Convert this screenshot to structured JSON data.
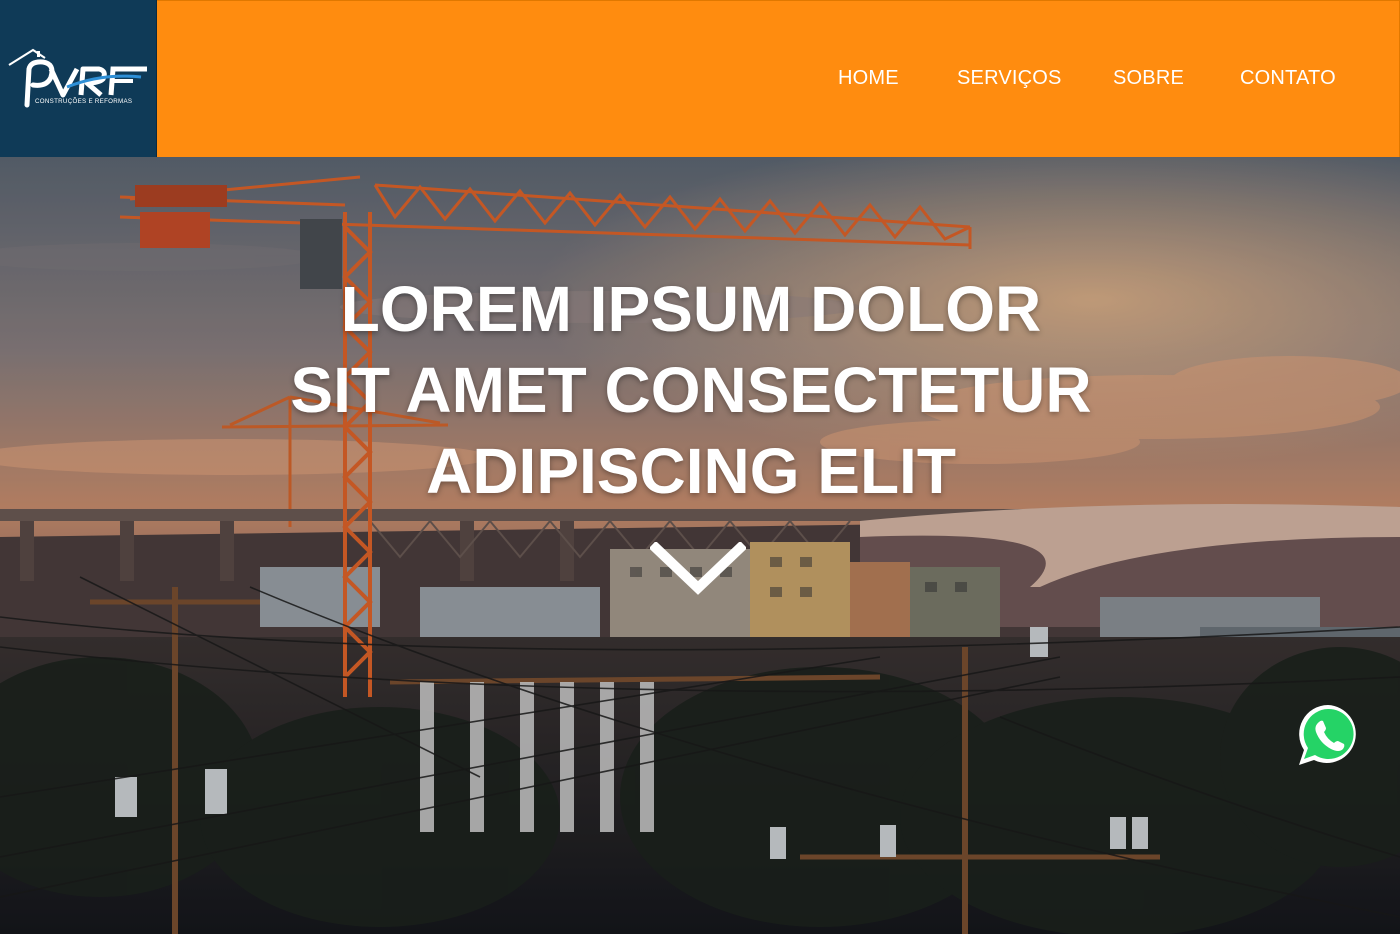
{
  "brand": {
    "logo_text": "PVRF",
    "tagline": "CONSTRUÇÕES E REFORMAS"
  },
  "nav": {
    "items": [
      {
        "label": "HOME"
      },
      {
        "label": "SERVIÇOS"
      },
      {
        "label": "SOBRE"
      },
      {
        "label": "CONTATO"
      }
    ]
  },
  "hero": {
    "title_lines": [
      "LOREM IPSUM DOLOR",
      "SIT AMET CONSECTETUR",
      "ADIPISCING ELIT"
    ],
    "scroll_icon": "chevron-down-icon",
    "background": "construction-crane-sunset"
  },
  "whatsapp": {
    "icon": "whatsapp-icon"
  },
  "colors": {
    "nav_orange": "#ff8c0f",
    "logo_navy": "#0f3a57",
    "crane_orange": "#e0642a",
    "whatsapp_green": "#25d366"
  }
}
